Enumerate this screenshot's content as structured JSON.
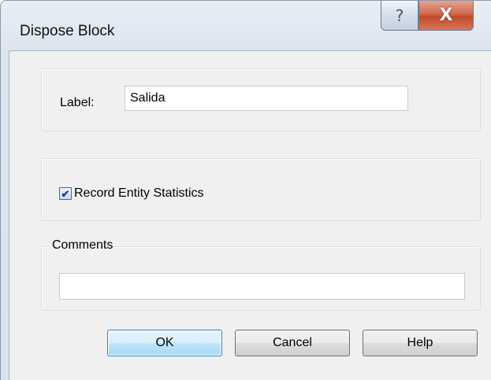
{
  "window": {
    "title": "Dispose Block",
    "help_glyph": "?",
    "close_glyph": "X"
  },
  "label_field": {
    "label": "Label:",
    "value": "Salida"
  },
  "statistics": {
    "checkbox_label": "Record Entity Statistics",
    "checked": true,
    "check_glyph": "✔"
  },
  "comments": {
    "legend": "Comments",
    "value": ""
  },
  "buttons": {
    "ok": "OK",
    "cancel": "Cancel",
    "help": "Help"
  },
  "icons": {
    "help": "help-icon",
    "close": "close-icon",
    "check": "checkmark-icon"
  }
}
